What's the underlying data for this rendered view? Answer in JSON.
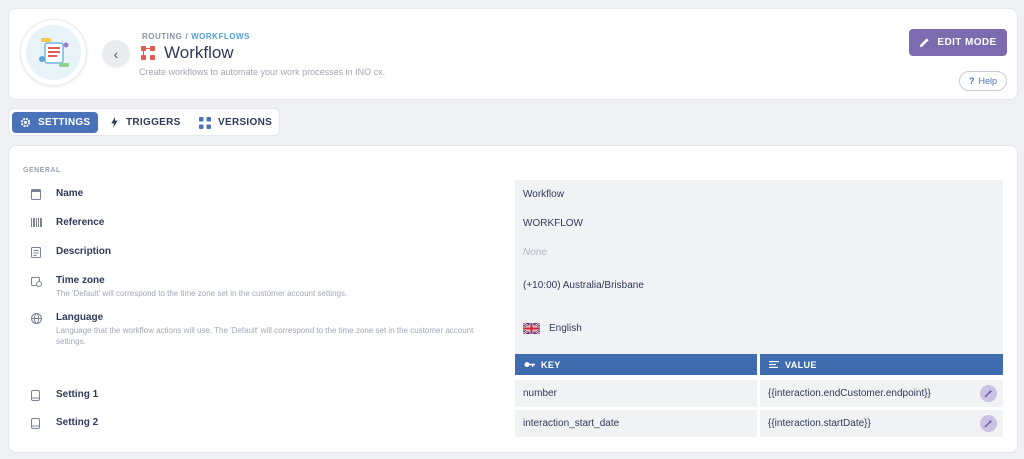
{
  "header": {
    "breadcrumb_root": "ROUTING",
    "breadcrumb_separator": "/",
    "breadcrumb_current": "WORKFLOWS",
    "title": "Workflow",
    "subtitle": "Create workflows to automate your work processes in INO cx.",
    "edit_mode_label": "EDIT MODE",
    "help_label": "Help",
    "accent_color": "#7c6bae"
  },
  "tabs": [
    {
      "label": "SETTINGS",
      "icon": "gear-icon",
      "active": true
    },
    {
      "label": "TRIGGERS",
      "icon": "bolt-icon",
      "active": false
    },
    {
      "label": "VERSIONS",
      "icon": "versions-icon",
      "active": false
    }
  ],
  "general": {
    "section_label": "GENERAL",
    "name": {
      "label": "Name",
      "value": "Workflow"
    },
    "reference": {
      "label": "Reference",
      "value": "WORKFLOW"
    },
    "description": {
      "label": "Description",
      "value": "None"
    },
    "time_zone": {
      "label": "Time zone",
      "desc": "The 'Default' will correspond to the time zone set in the customer account settings.",
      "value": "(+10:00) Australia/Brisbane"
    },
    "language": {
      "label": "Language",
      "desc": "Language that the workflow actions will use. The 'Default' will correspond to the time zone set in the customer account settings.",
      "value": "English"
    }
  },
  "settings_table": {
    "key_header": "KEY",
    "value_header": "VALUE",
    "rows": [
      {
        "label": "Setting 1",
        "key": "number",
        "value": "{{interaction.endCustomer.endpoint}}"
      },
      {
        "label": "Setting 2",
        "key": "interaction_start_date",
        "value": "{{interaction.startDate}}"
      }
    ]
  }
}
